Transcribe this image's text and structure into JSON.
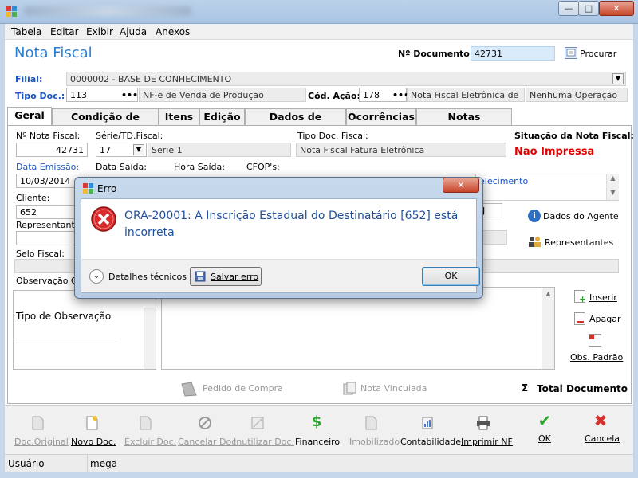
{
  "window": {
    "minimize": "—",
    "maximize": "□",
    "close": "✕"
  },
  "menu": [
    "Tabela",
    "Editar",
    "Exibir",
    "Ajuda",
    "Anexos"
  ],
  "header": {
    "title": "Nota Fiscal",
    "doc_label": "Nº Documento:",
    "doc_value": "42731",
    "search_label": "Procurar"
  },
  "filial": {
    "label": "Filial:",
    "value": "0000002 - BASE DE CONHECIMENTO"
  },
  "tipo_doc": {
    "label": "Tipo Doc.:",
    "code": "113",
    "dots": "•••",
    "desc": "NF-e de Venda de Produção",
    "acao_label": "Cód. Ação:",
    "acao_code": "178",
    "acao_desc": "Nota Fiscal Eletrônica de",
    "acao_extra": "Nenhuma Operação"
  },
  "tabs": [
    "Geral",
    "Condição de Venda",
    "Itens",
    "Edição",
    "Dados de Entrega",
    "Ocorrências",
    "Notas Vinculadas"
  ],
  "geral": {
    "nf_label": "Nº Nota Fiscal:",
    "nf_value": "42731",
    "serie_label": "Série/TD.Fiscal:",
    "serie_value": "17",
    "serie_desc": "Serie 1",
    "tipo_fiscal_label": "Tipo Doc. Fiscal:",
    "tipo_fiscal_value": "Nota Fiscal Fatura Eletrônica",
    "situacao_label": "Situação da Nota Fiscal:",
    "situacao_value": "Não Impressa",
    "emissao_label": "Data Emissão:",
    "emissao_value": "10/03/2014",
    "saida_label": "Data Saída:",
    "hora_label": "Hora Saída:",
    "cfop_label": "CFOP's:",
    "cfop_fragment": "elecimento",
    "cliente_label": "Cliente:",
    "cliente_value": "652",
    "cliente_fragment": "J",
    "representante_label": "Representante",
    "selo_label": "Selo Fiscal:",
    "obs_label": "Observação Ge",
    "tipo_obs_label": "Tipo de Observação",
    "dados_agente": "Dados do Agente",
    "representantes": "Representantes",
    "inserir": "Inserir",
    "apagar": "Apagar",
    "obs_padrao": "Obs. Padrão",
    "pedido_compra": "Pedido de Compra",
    "nota_vinculada": "Nota Vinculada",
    "total_documento": "Total Documento",
    "sigma": "Σ"
  },
  "toolbar": [
    {
      "label": "Doc.Original",
      "enabled": false
    },
    {
      "label": "Novo Doc.",
      "enabled": true
    },
    {
      "label": "Excluir Doc.",
      "enabled": false
    },
    {
      "label": "Cancelar Doc.",
      "enabled": false
    },
    {
      "label": "Inutilizar Doc.",
      "enabled": false
    },
    {
      "label": "Financeiro",
      "enabled": true
    },
    {
      "label": "Imobilizado",
      "enabled": false
    },
    {
      "label": "Contabilidade",
      "enabled": true
    },
    {
      "label": "Imprimir NF",
      "enabled": true
    },
    {
      "label": "OK",
      "enabled": true
    },
    {
      "label": "Cancela",
      "enabled": true
    }
  ],
  "status": {
    "label": "Usuário",
    "value": "mega"
  },
  "dialog": {
    "title": "Erro",
    "close": "✕",
    "message": "ORA-20001: A Inscrição Estadual do Destinatário [652] está incorreta",
    "details": "Detalhes técnicos",
    "save": "Salvar erro",
    "ok": "OK"
  },
  "colors": {
    "accent_blue": "#2a7fd4",
    "error_red": "#e00000",
    "ok_green": "#2ca52c",
    "cancel_red": "#d3322c",
    "dialog_message": "#1f4f9a"
  }
}
